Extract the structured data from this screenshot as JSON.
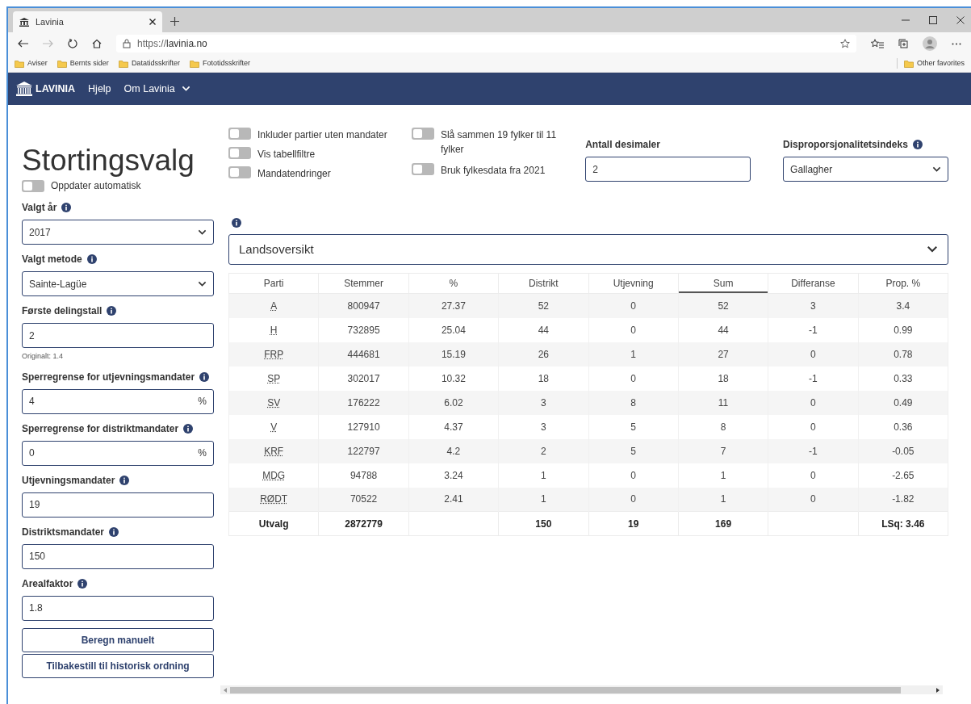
{
  "browser": {
    "tab_title": "Lavinia",
    "url_scheme": "https://",
    "url_host": "lavinia.no",
    "bookmarks": [
      "Aviser",
      "Bernts sider",
      "Datatidsskrifter",
      "Fototidsskrifter"
    ],
    "other_favorites": "Other favorites"
  },
  "navbar": {
    "brand": "LAVINIA",
    "links": [
      {
        "label": "Hjelp",
        "kind": "link"
      },
      {
        "label": "Om Lavinia",
        "kind": "dropdown"
      }
    ]
  },
  "sidebar": {
    "title": "Stortingsvalg",
    "auto_update": {
      "label": "Oppdater automatisk",
      "on": false
    },
    "fields": [
      {
        "kind": "select",
        "label": "Valgt år",
        "value": "2017"
      },
      {
        "kind": "select",
        "label": "Valgt metode",
        "value": "Sainte-Lagüe"
      },
      {
        "kind": "input",
        "label": "Første delingstall",
        "value": "2",
        "note": "Originalt: 1.4"
      },
      {
        "kind": "percent",
        "label": "Sperregrense for utjevningsmandater",
        "value": "4",
        "suffix": "%"
      },
      {
        "kind": "percent",
        "label": "Sperregrense for distriktmandater",
        "value": "0",
        "suffix": "%"
      },
      {
        "kind": "input",
        "label": "Utjevningsmandater",
        "value": "19"
      },
      {
        "kind": "input",
        "label": "Distriktsmandater",
        "value": "150"
      },
      {
        "kind": "input",
        "label": "Arealfaktor",
        "value": "1.8"
      }
    ],
    "buttons": [
      "Beregn manuelt",
      "Tilbakestill til historisk ordning"
    ]
  },
  "toggle_groups": [
    [
      {
        "label": "Inkluder partier uten mandater",
        "on": false
      },
      {
        "label": "Vis tabellfiltre",
        "on": false
      },
      {
        "label": "Mandatendringer",
        "on": false
      }
    ],
    [
      {
        "label": "Slå sammen 19 fylker til 11 fylker",
        "on": false
      },
      {
        "label": "Bruk fylkesdata fra 2021",
        "on": false
      }
    ]
  ],
  "decimals": {
    "label": "Antall desimaler",
    "value": "2"
  },
  "index_select": {
    "label": "Disproporsjonalitetsindeks",
    "value": "Gallagher"
  },
  "area_select": {
    "value": "Landsoversikt"
  },
  "table": {
    "columns": [
      {
        "label": "Parti",
        "sorted": false
      },
      {
        "label": "Stemmer",
        "sorted": false
      },
      {
        "label": "%",
        "sorted": false
      },
      {
        "label": "Distrikt",
        "sorted": false
      },
      {
        "label": "Utjevning",
        "sorted": false
      },
      {
        "label": "Sum",
        "sorted": true
      },
      {
        "label": "Differanse",
        "sorted": false
      },
      {
        "label": "Prop. %",
        "sorted": false
      }
    ],
    "rows": [
      [
        "A",
        "800947",
        "27.37",
        "52",
        "0",
        "52",
        "3",
        "3.4"
      ],
      [
        "H",
        "732895",
        "25.04",
        "44",
        "0",
        "44",
        "-1",
        "0.99"
      ],
      [
        "FRP",
        "444681",
        "15.19",
        "26",
        "1",
        "27",
        "0",
        "0.78"
      ],
      [
        "SP",
        "302017",
        "10.32",
        "18",
        "0",
        "18",
        "-1",
        "0.33"
      ],
      [
        "SV",
        "176222",
        "6.02",
        "3",
        "8",
        "11",
        "0",
        "0.49"
      ],
      [
        "V",
        "127910",
        "4.37",
        "3",
        "5",
        "8",
        "0",
        "0.36"
      ],
      [
        "KRF",
        "122797",
        "4.2",
        "2",
        "5",
        "7",
        "-1",
        "-0.05"
      ],
      [
        "MDG",
        "94788",
        "3.24",
        "1",
        "0",
        "1",
        "0",
        "-2.65"
      ],
      [
        "RØDT",
        "70522",
        "2.41",
        "1",
        "0",
        "1",
        "0",
        "-1.82"
      ]
    ],
    "footer": {
      "parti": "Utvalg",
      "stemmer": "2872779",
      "distrikt": "150",
      "utjevning": "19",
      "sum": "169",
      "prop": "LSq: 3.46"
    }
  }
}
